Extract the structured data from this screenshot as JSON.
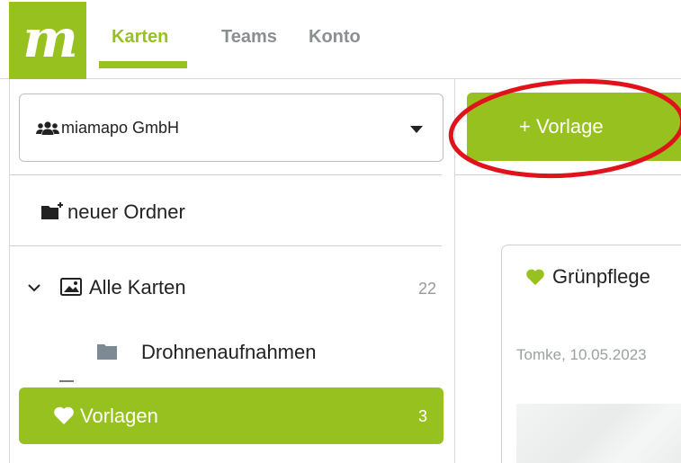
{
  "app": {
    "logo_text": "m",
    "brand_color": "#97c11f"
  },
  "nav": {
    "tabs": [
      {
        "label": "Karten",
        "active": true
      },
      {
        "label": "Teams",
        "active": false
      },
      {
        "label": "Konto",
        "active": false
      }
    ]
  },
  "sidebar": {
    "team_select": {
      "value": "miamapo GmbH",
      "icon": "users-icon"
    },
    "new_folder_label": "neuer Ordner",
    "all_maps": {
      "label": "Alle Karten",
      "count": "22",
      "expanded": true
    },
    "folder": {
      "label": "Drohnenaufnahmen"
    },
    "vorlagen": {
      "label": "Vorlagen",
      "count": "3",
      "selected": true
    }
  },
  "main": {
    "add_template_button": "+ Vorlage",
    "card": {
      "title": "Grünpflege",
      "meta": "Tomke, 10.05.2023"
    }
  },
  "annotation": {
    "shape": "red-ellipse-highlight",
    "color": "#e0121b"
  }
}
